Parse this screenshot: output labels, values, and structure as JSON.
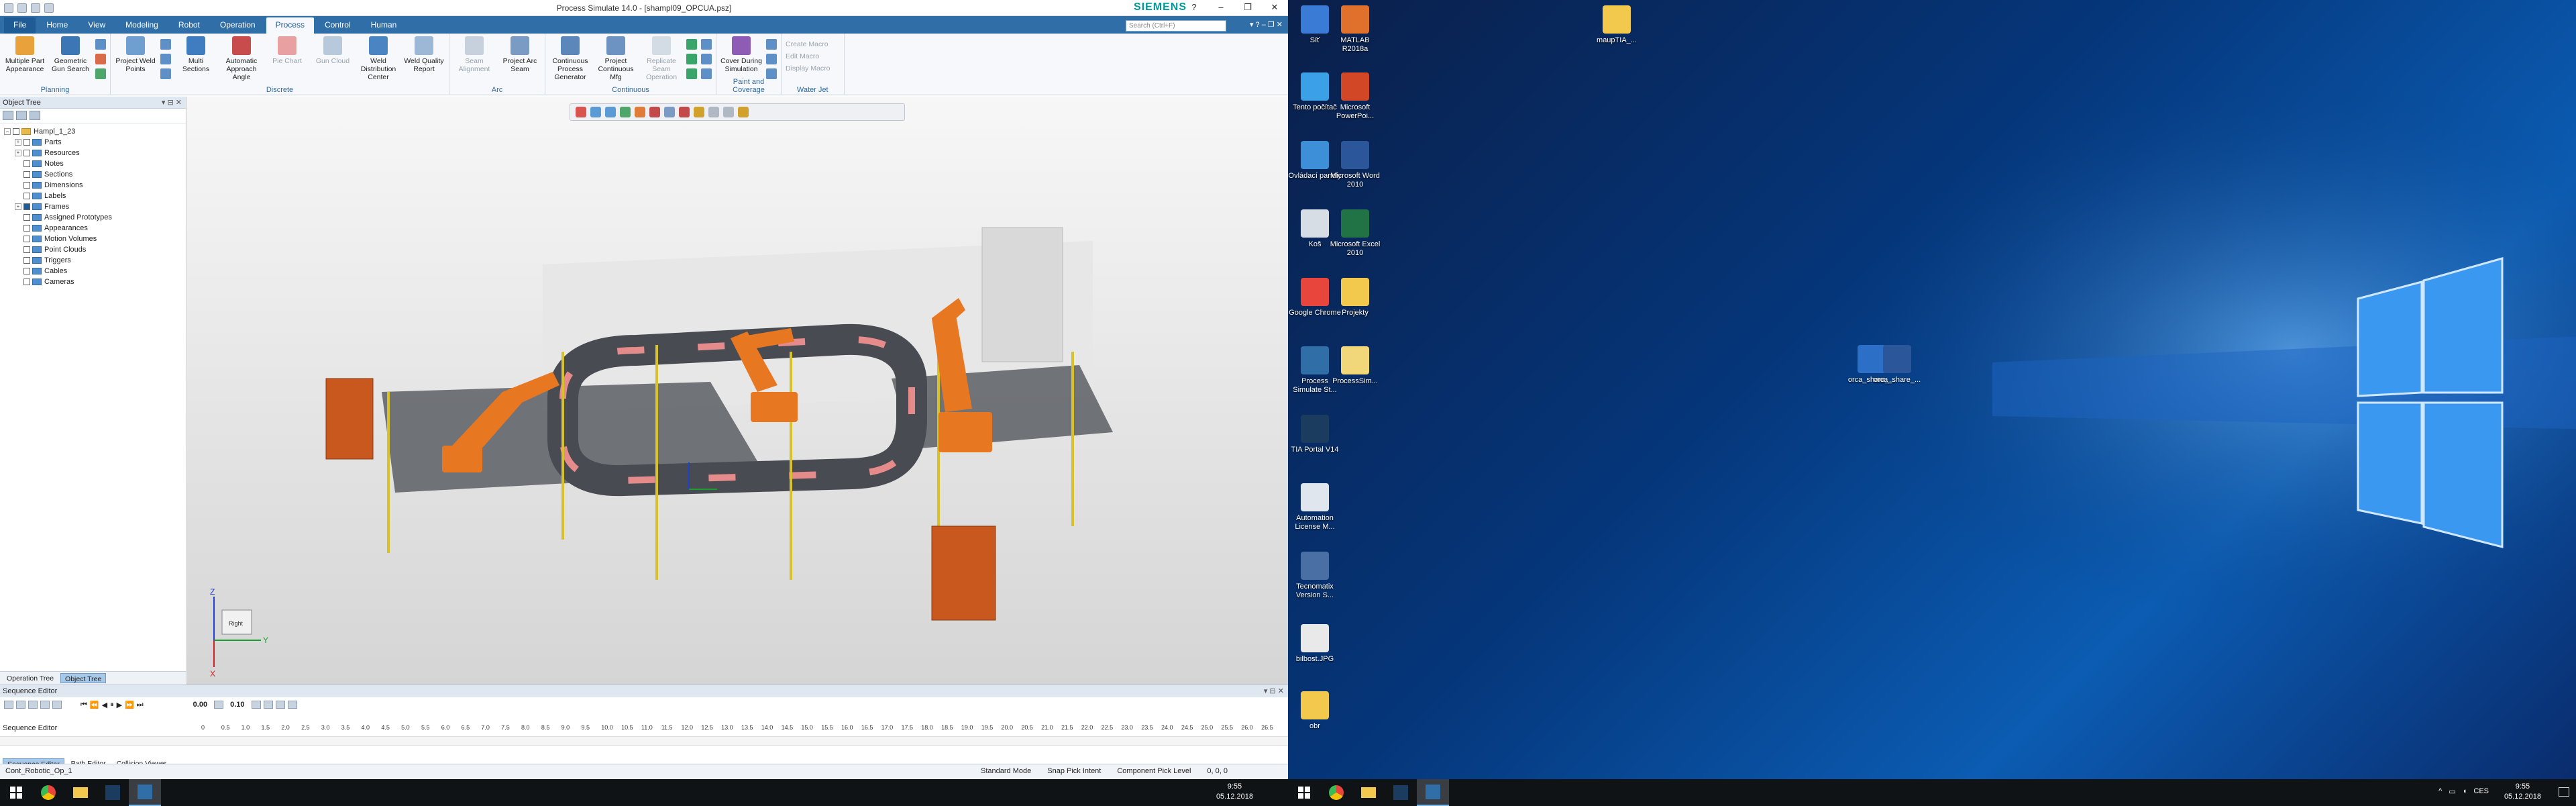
{
  "app": {
    "title": "Process Simulate 14.0 - [shampl09_OPCUA.psz]",
    "brand": "SIEMENS",
    "search_placeholder": "Search (Ctrl+F)",
    "window_controls": [
      "?",
      "–",
      "❐",
      "✕"
    ]
  },
  "ribbon_tabs": [
    "File",
    "Home",
    "View",
    "Modeling",
    "Robot",
    "Operation",
    "Process",
    "Control",
    "Human"
  ],
  "active_tab": "Process",
  "ribbon_groups": [
    {
      "label": "Planning",
      "buttons": [
        "Multiple Part Appearance",
        "Geometric Gun Search"
      ]
    },
    {
      "label": "Discrete",
      "buttons": [
        "Project Weld Points",
        "Multi Sections",
        "Automatic Approach Angle",
        "Pie Chart",
        "Gun Cloud",
        "Weld Distribution Center",
        "Weld Quality Report"
      ]
    },
    {
      "label": "Arc",
      "buttons": [
        "Seam Alignment",
        "Project Arc Seam"
      ]
    },
    {
      "label": "Continuous",
      "buttons": [
        "Continuous Process Generator",
        "Project Continuous Mfg",
        "Replicate Seam Operation"
      ]
    },
    {
      "label": "Paint and Coverage",
      "buttons": [
        "Cover During Simulation"
      ]
    },
    {
      "label": "Water Jet",
      "buttons": [
        "Create Macro",
        "Edit Macro",
        "Display Macro"
      ]
    }
  ],
  "object_tree": {
    "title": "Object Tree",
    "root": "Hampl_1_23",
    "items": [
      "Parts",
      "Resources",
      "Notes",
      "Sections",
      "Dimensions",
      "Labels",
      "Frames",
      "Assigned Prototypes",
      "Appearances",
      "Motion Volumes",
      "Point Clouds",
      "Triggers",
      "Cables",
      "Cameras"
    ],
    "tabs": [
      "Operation Tree",
      "Object Tree"
    ],
    "active_tab": "Object Tree"
  },
  "viewport": {
    "axis_x": "X",
    "axis_y": "Y",
    "axis_z": "Z",
    "cube_label": "Right"
  },
  "sequence_editor": {
    "title": "Sequence Editor",
    "time_current": "0.00",
    "time_step": "0.10",
    "row_label": "Sequence Editor",
    "ruler": [
      "0",
      "0.5",
      "1.0",
      "1.5",
      "2.0",
      "2.5",
      "3.0",
      "3.5",
      "4.0",
      "4.5",
      "5.0",
      "5.5",
      "6.0",
      "6.5",
      "7.0",
      "7.5",
      "8.0",
      "8.5",
      "9.0",
      "9.5",
      "10.0",
      "10.5",
      "11.0",
      "11.5",
      "12.0",
      "12.5",
      "13.0",
      "13.5",
      "14.0",
      "14.5",
      "15.0",
      "15.5",
      "16.0",
      "16.5",
      "17.0",
      "17.5",
      "18.0",
      "18.5",
      "19.0",
      "19.5",
      "20.0",
      "20.5",
      "21.0",
      "21.5",
      "22.0",
      "22.5",
      "23.0",
      "23.5",
      "24.0",
      "24.5",
      "25.0",
      "25.5",
      "26.0",
      "26.5"
    ],
    "tabs": [
      "Sequence Editor",
      "Path Editor",
      "Collision Viewer"
    ]
  },
  "status_bar": {
    "operation": "Cont_Robotic_Op_1",
    "mode": "Standard Mode",
    "pick_intent": "Snap Pick Intent",
    "pick_level": "Component Pick Level",
    "coords": "0, 0, 0"
  },
  "taskbar": {
    "time": "9:55",
    "date": "05.12.2018",
    "lang": "CES"
  },
  "desktop_icons": [
    {
      "label": "Síť",
      "color": "#3a7bd5"
    },
    {
      "label": "MATLAB R2018a",
      "color": "#e0712d"
    },
    {
      "label": "Tento počítač",
      "color": "#3ba0e6"
    },
    {
      "label": "Microsoft PowerPoi...",
      "color": "#d24726"
    },
    {
      "label": "Ovládací panely",
      "color": "#3d8fd8"
    },
    {
      "label": "Microsoft Word 2010",
      "color": "#2b579a"
    },
    {
      "label": "Koš",
      "color": "#d7dde5"
    },
    {
      "label": "Microsoft Excel 2010",
      "color": "#217346"
    },
    {
      "label": "Google Chrome",
      "color": "#e8453c"
    },
    {
      "label": "Projekty",
      "color": "#f2c94c"
    },
    {
      "label": "Process Simulate St...",
      "color": "#2f6ea7"
    },
    {
      "label": "ProcessSim...",
      "color": "#f2d77a"
    },
    {
      "label": "TIA Portal V14",
      "color": "#1b3b5f"
    },
    {
      "label": "Automation License M...",
      "color": "#dfe6ee"
    },
    {
      "label": "Tecnomatix Version S...",
      "color": "#4a6fa5"
    },
    {
      "label": "bilbost.JPG",
      "color": "#e9e9e9"
    },
    {
      "label": "obr",
      "color": "#f2c94c"
    },
    {
      "label": "maupTIA_...",
      "color": "#f2c94c"
    },
    {
      "label": "orca_share_...",
      "color": "#2b6fc7"
    },
    {
      "label": "orca_share_...",
      "color": "#2b579a"
    }
  ]
}
